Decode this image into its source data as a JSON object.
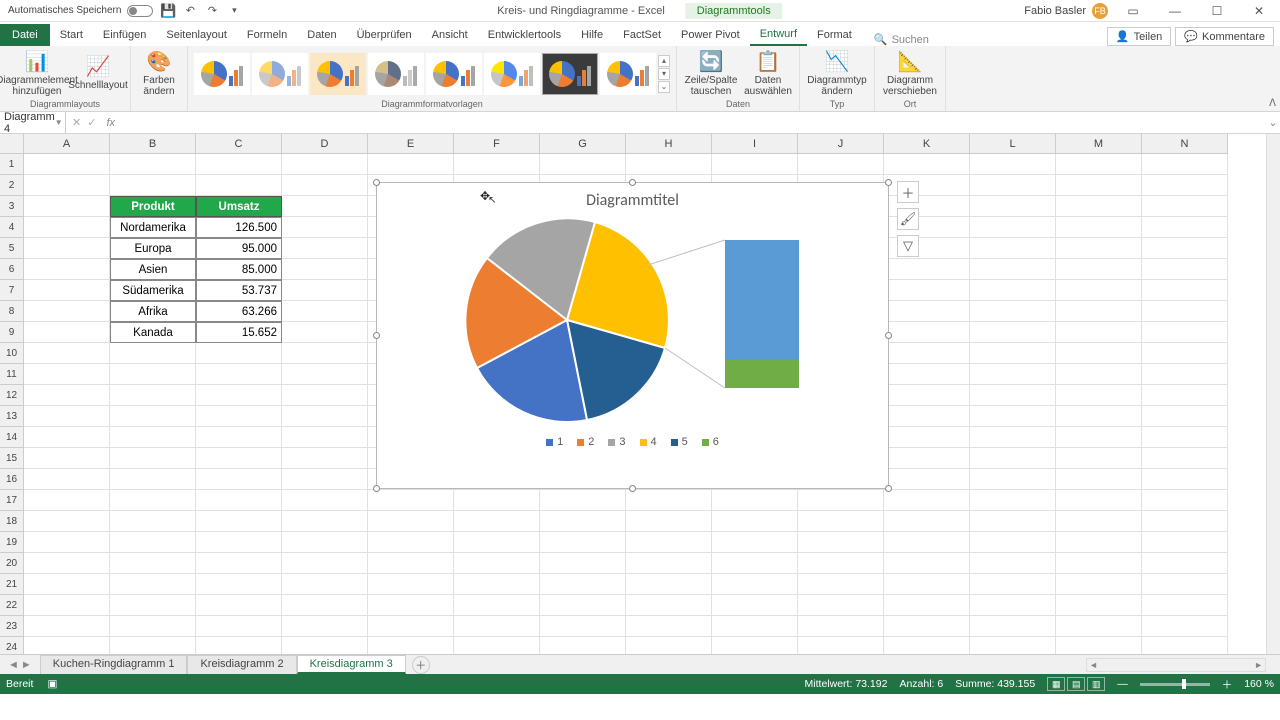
{
  "titlebar": {
    "autosave_label": "Automatisches Speichern",
    "doc_title": "Kreis- und Ringdiagramme  -  Excel",
    "tool_context": "Diagrammtools",
    "user_name": "Fabio Basler",
    "user_initials": "FB"
  },
  "menu": {
    "file": "Datei",
    "tabs": [
      "Start",
      "Einfügen",
      "Seitenlayout",
      "Formeln",
      "Daten",
      "Überprüfen",
      "Ansicht",
      "Entwicklertools",
      "Hilfe",
      "FactSet",
      "Power Pivot",
      "Entwurf",
      "Format"
    ],
    "active_tab": "Entwurf",
    "search_placeholder": "Suchen",
    "share": "Teilen",
    "comments": "Kommentare"
  },
  "ribbon": {
    "group1": {
      "btn1": "Diagrammelement hinzufügen",
      "btn2": "Schnelllayout",
      "label": "Diagrammlayouts"
    },
    "group2": {
      "btn": "Farben ändern"
    },
    "group3": {
      "label": "Diagrammformatvorlagen"
    },
    "group4": {
      "btn1": "Zeile/Spalte tauschen",
      "btn2": "Daten auswählen",
      "label": "Daten"
    },
    "group5": {
      "btn": "Diagrammtyp ändern",
      "label": "Typ"
    },
    "group6": {
      "btn": "Diagramm verschieben",
      "label": "Ort"
    }
  },
  "name_box": "Diagramm 4",
  "columns": [
    "A",
    "B",
    "C",
    "D",
    "E",
    "F",
    "G",
    "H",
    "I",
    "J",
    "K",
    "L",
    "M",
    "N"
  ],
  "row_count": 24,
  "table": {
    "header": {
      "col1": "Produkt",
      "col2": "Umsatz"
    },
    "rows": [
      {
        "product": "Nordamerika",
        "value": "126.500"
      },
      {
        "product": "Europa",
        "value": "95.000"
      },
      {
        "product": "Asien",
        "value": "85.000"
      },
      {
        "product": "Südamerika",
        "value": "53.737"
      },
      {
        "product": "Afrika",
        "value": "63.266"
      },
      {
        "product": "Kanada",
        "value": "15.652"
      }
    ]
  },
  "chart_data": {
    "type": "pie",
    "title": "Diagrammtitel",
    "categories": [
      "1",
      "2",
      "3",
      "4",
      "5",
      "6"
    ],
    "values": [
      126500,
      95000,
      85000,
      53737,
      63266,
      15652
    ],
    "colors": [
      "#4472c4",
      "#ed7d31",
      "#a5a5a5",
      "#ffc000",
      "#255e91",
      "#70ad47"
    ],
    "subtype": "bar-of-pie",
    "legend_position": "bottom"
  },
  "sheets": {
    "tabs": [
      "Kuchen-Ringdiagramm 1",
      "Kreisdiagramm 2",
      "Kreisdiagramm 3"
    ],
    "active": "Kreisdiagramm 3"
  },
  "status": {
    "ready": "Bereit",
    "avg_label": "Mittelwert:",
    "avg": "73.192",
    "count_label": "Anzahl:",
    "count": "6",
    "sum_label": "Summe:",
    "sum": "439.155",
    "zoom": "160 %"
  }
}
